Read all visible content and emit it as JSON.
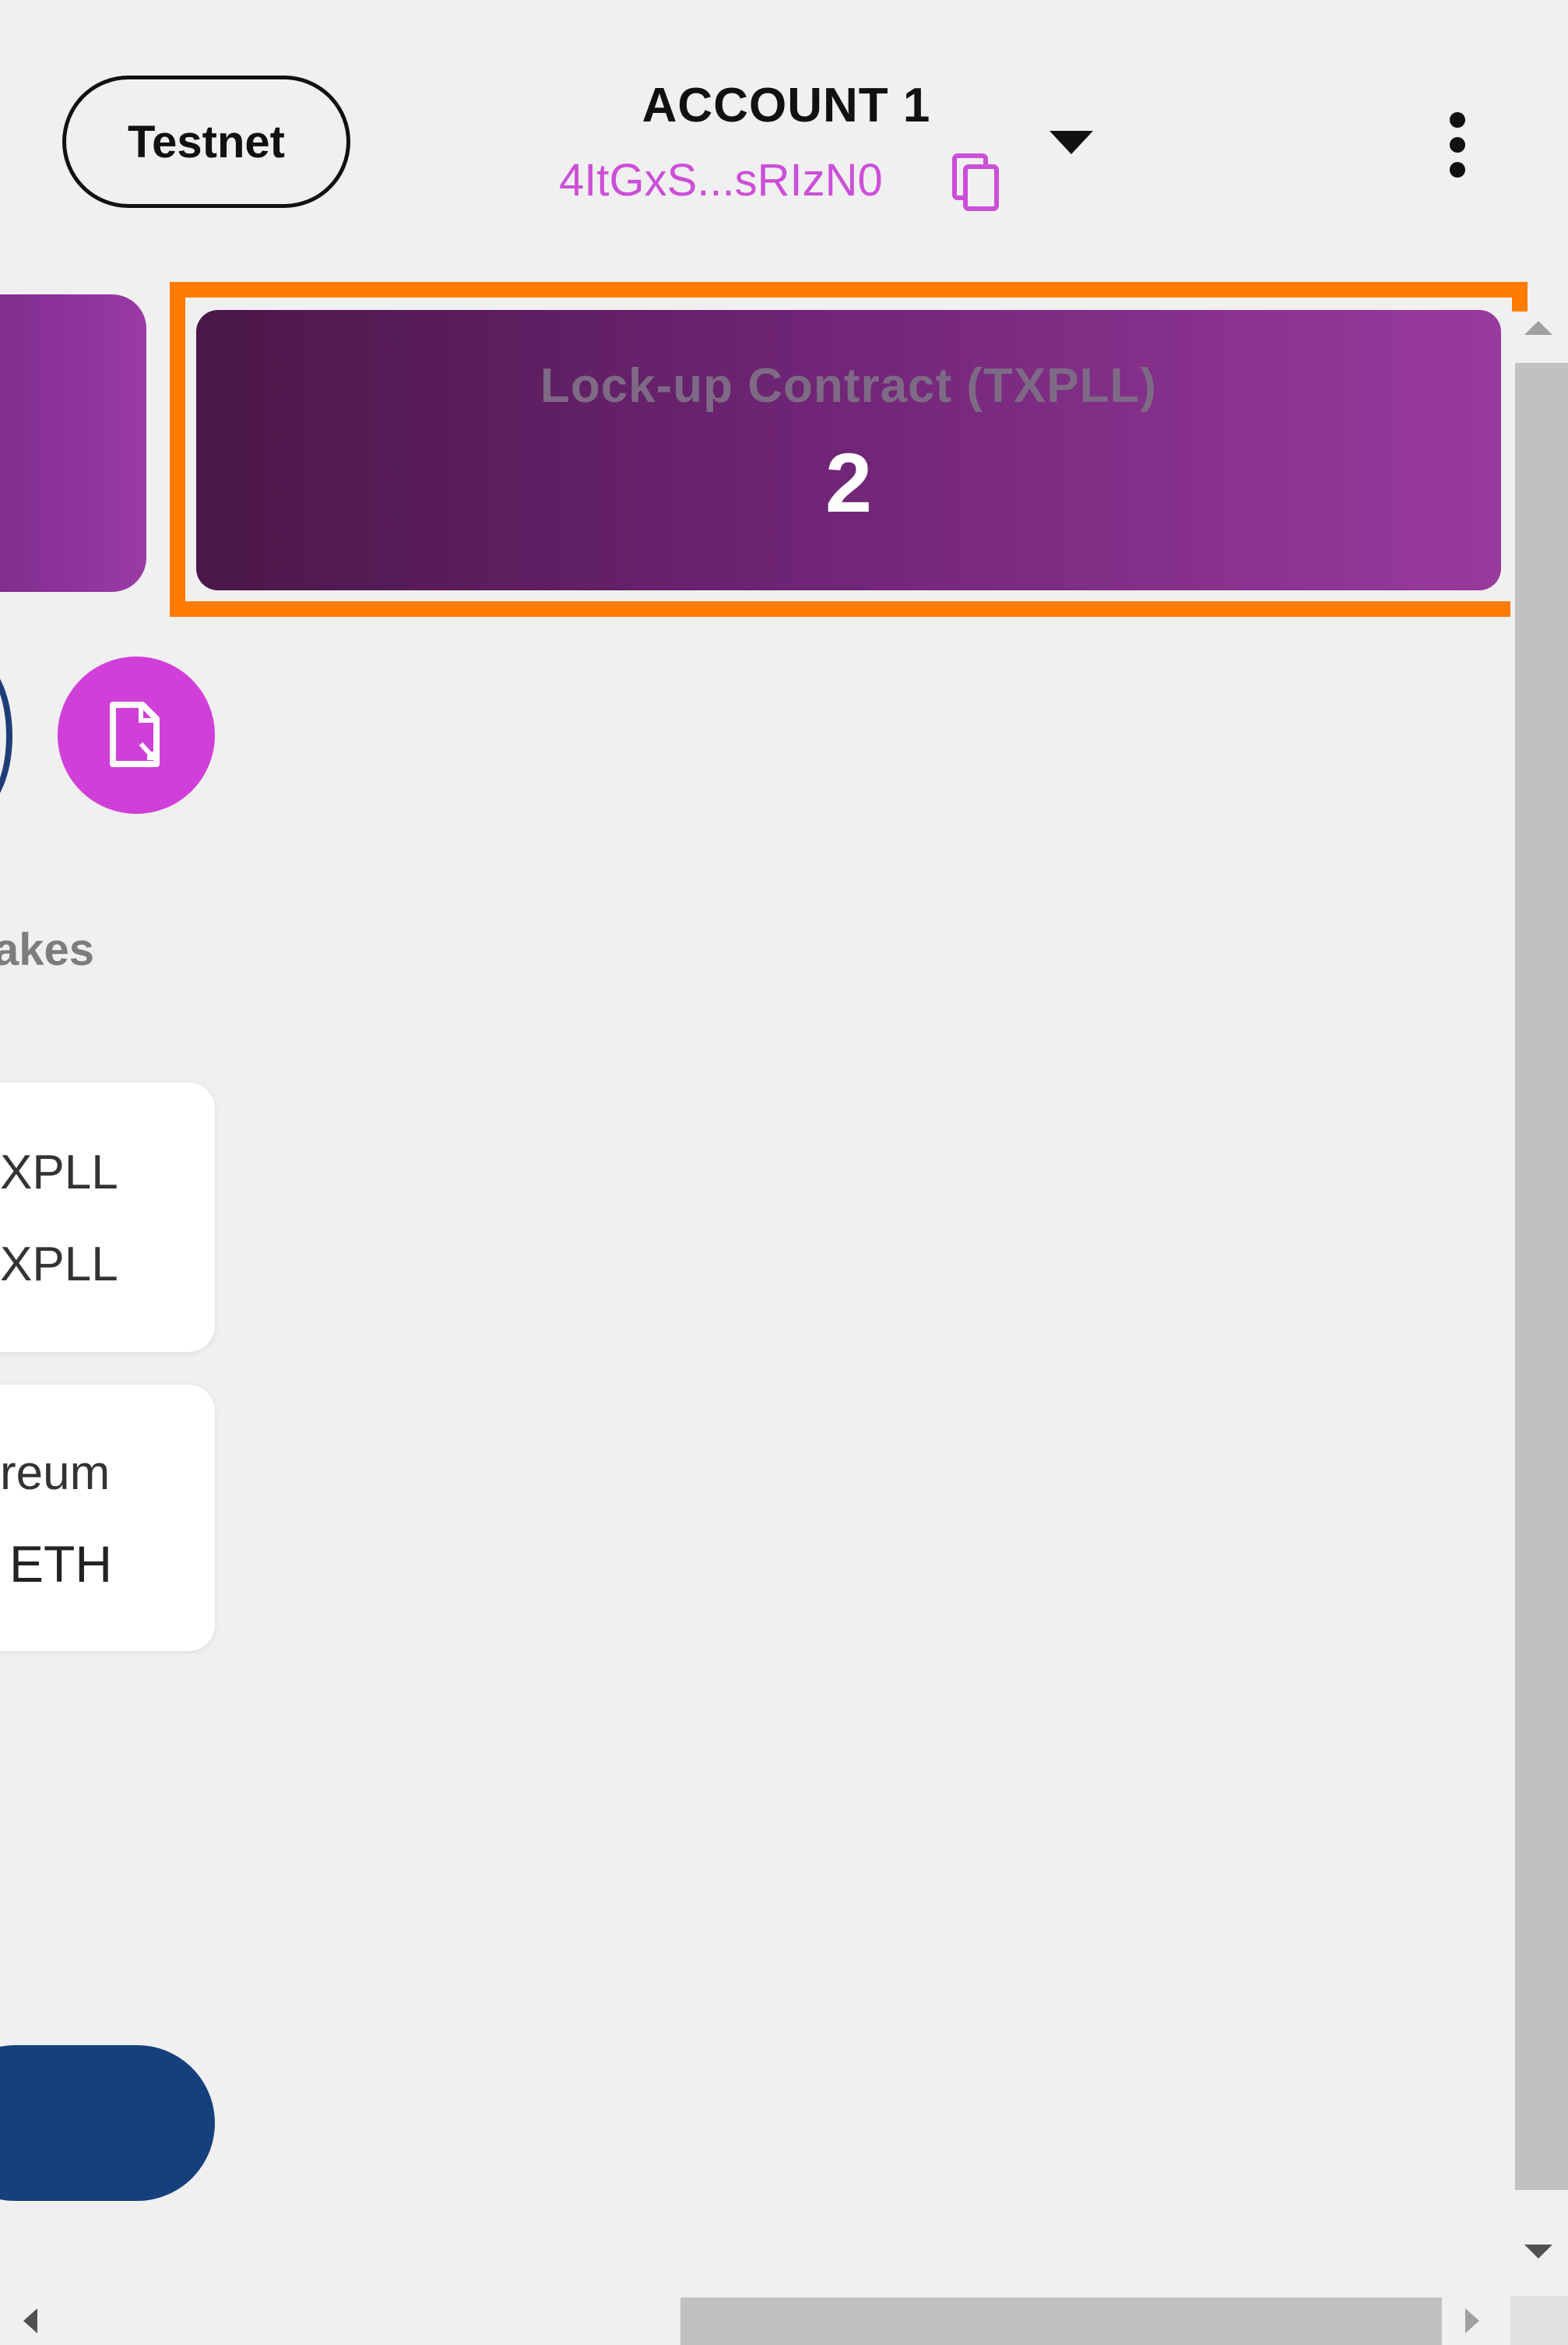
{
  "header": {
    "network_label": "Testnet",
    "account_title": "ACCOUNT 1",
    "account_address": "4ItGxS...sRIzN0"
  },
  "lockup": {
    "label": "Lock-up Contract (TXPLL)",
    "value": "2"
  },
  "section": {
    "stakes_label": "akes"
  },
  "assets": [
    {
      "line1": "XPLL",
      "line2": "XPLL"
    },
    {
      "line1": "reum",
      "line2": "ETH"
    }
  ],
  "colors": {
    "highlight": "#ff7a00",
    "accent_pink": "#d13fd9",
    "primary_blue": "#15407c",
    "card_gradient_start": "#4a1748",
    "card_gradient_end": "#993a9e"
  },
  "icons": [
    "copy-icon",
    "chevron-down-icon",
    "more-vert-icon",
    "file-icon"
  ]
}
